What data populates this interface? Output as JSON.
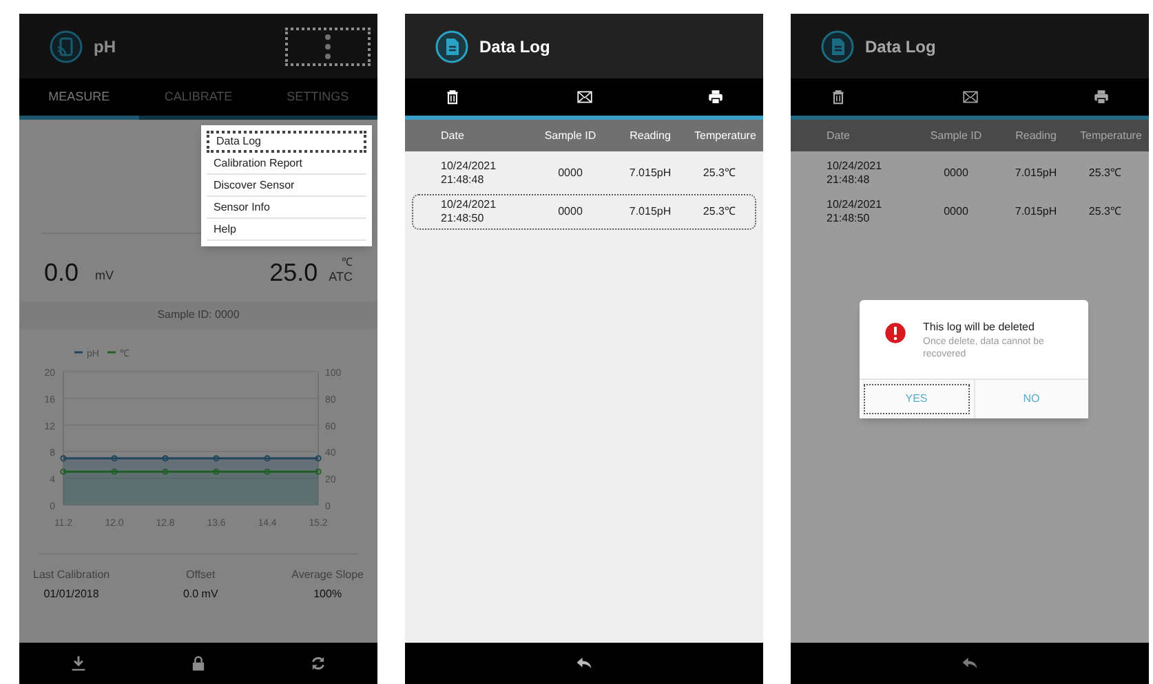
{
  "screens": [
    {
      "kind": "measure",
      "dimmed": true,
      "title": "pH",
      "menu_button": {
        "highlighted": true
      },
      "tabs": [
        {
          "label": "MEASURE",
          "selected": true
        },
        {
          "label": "CALIBRATE",
          "selected": false
        },
        {
          "label": "SETTINGS",
          "selected": false
        }
      ],
      "menu": [
        {
          "label": "Data Log",
          "highlighted": true
        },
        {
          "label": "Calibration Report",
          "highlighted": false
        },
        {
          "label": "Discover Sensor",
          "highlighted": false
        },
        {
          "label": "Sensor Info",
          "highlighted": false
        },
        {
          "label": "Help",
          "highlighted": false
        }
      ],
      "readings": {
        "mv_value": "0.0",
        "mv_unit": "mV",
        "temp_value": "25.0",
        "temp_unit": "℃",
        "temp_mode": "ATC"
      },
      "sample_id": "Sample ID: 0000",
      "chart_data": {
        "type": "area",
        "categories": [
          "11.2",
          "12.0",
          "12.8",
          "13.6",
          "14.4",
          "15.2"
        ],
        "ylim": [
          0,
          20
        ],
        "yticks": [
          0,
          4,
          8,
          12,
          16,
          20
        ],
        "y2lim": [
          0,
          100
        ],
        "y2ticks": [
          0,
          20,
          40,
          60,
          80,
          100
        ],
        "grid": true,
        "legend": true,
        "series": [
          {
            "name": "pH",
            "color": "#3b7fa8",
            "marker": "o",
            "values": [
              7.0,
              7.0,
              7.0,
              7.0,
              7.0,
              7.0
            ]
          },
          {
            "name": "℃",
            "color": "#3fae4a",
            "marker": "o",
            "axis": "y2",
            "values": [
              25,
              25,
              25,
              25,
              25,
              25
            ]
          }
        ]
      },
      "stats": [
        {
          "label": "Last Calibration",
          "value": "01/01/2018"
        },
        {
          "label": "Offset",
          "value": "0.0 mV"
        },
        {
          "label": "Average Slope",
          "value": "100%"
        }
      ]
    },
    {
      "kind": "log",
      "dimmed": false,
      "title": "Data Log",
      "columns": [
        "Date",
        "Sample ID",
        "Reading",
        "Temperature"
      ],
      "rows": [
        {
          "cells": [
            "10/24/2021\n21:48:48",
            "0000",
            "7.015pH",
            "25.3℃"
          ],
          "highlighted": false
        },
        {
          "cells": [
            "10/24/2021\n21:48:50",
            "0000",
            "7.015pH",
            "25.3℃"
          ],
          "highlighted": true
        }
      ]
    },
    {
      "kind": "log",
      "dimmed": true,
      "title": "Data Log",
      "columns": [
        "Date",
        "Sample ID",
        "Reading",
        "Temperature"
      ],
      "rows": [
        {
          "cells": [
            "10/24/2021\n21:48:48",
            "0000",
            "7.015pH",
            "25.3℃"
          ],
          "highlighted": false
        },
        {
          "cells": [
            "10/24/2021\n21:48:50",
            "0000",
            "7.015pH",
            "25.3℃"
          ],
          "highlighted": false
        }
      ],
      "dialog": {
        "title": "This log will be deleted",
        "message": "Once delete, data cannot be recovered",
        "buttons": [
          {
            "label": "YES",
            "highlighted": true
          },
          {
            "label": "NO",
            "highlighted": false
          }
        ]
      }
    }
  ]
}
